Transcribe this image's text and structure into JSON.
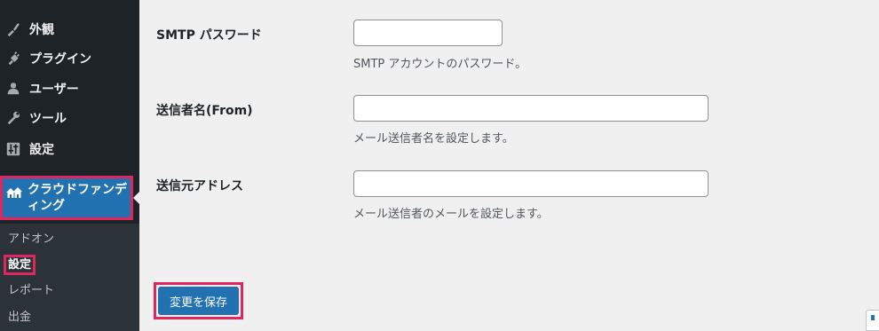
{
  "sidebar": {
    "items": [
      {
        "label": "外観",
        "icon": "appearance-brush-icon"
      },
      {
        "label": "プラグイン",
        "icon": "plugins-icon"
      },
      {
        "label": "ユーザー",
        "icon": "users-icon"
      },
      {
        "label": "ツール",
        "icon": "tools-wrench-icon"
      },
      {
        "label": "設定",
        "icon": "settings-sliders-icon"
      }
    ],
    "current": {
      "label": "クラウドファンディング",
      "icon": "crowdfunding-houses-icon"
    },
    "submenu": [
      {
        "label": "アドオン",
        "active": false
      },
      {
        "label": "設定",
        "active": true
      },
      {
        "label": "レポート",
        "active": false
      },
      {
        "label": "出金",
        "active": false
      }
    ],
    "highlight_color": "#e0265f"
  },
  "form": {
    "fields": [
      {
        "label": "SMTP パスワード",
        "value": "",
        "description": "SMTP アカウントのパスワード。"
      },
      {
        "label": "送信者名(From)",
        "value": "",
        "description": "メール送信者名を設定します。"
      },
      {
        "label": "送信元アドレス",
        "value": "",
        "description": "メール送信者のメールを設定します。"
      }
    ],
    "save_label": "変更を保存"
  },
  "colors": {
    "sidebar_bg": "#1d2327",
    "submenu_bg": "#2c3338",
    "accent": "#2271b1",
    "content_bg": "#f0f0f1"
  }
}
